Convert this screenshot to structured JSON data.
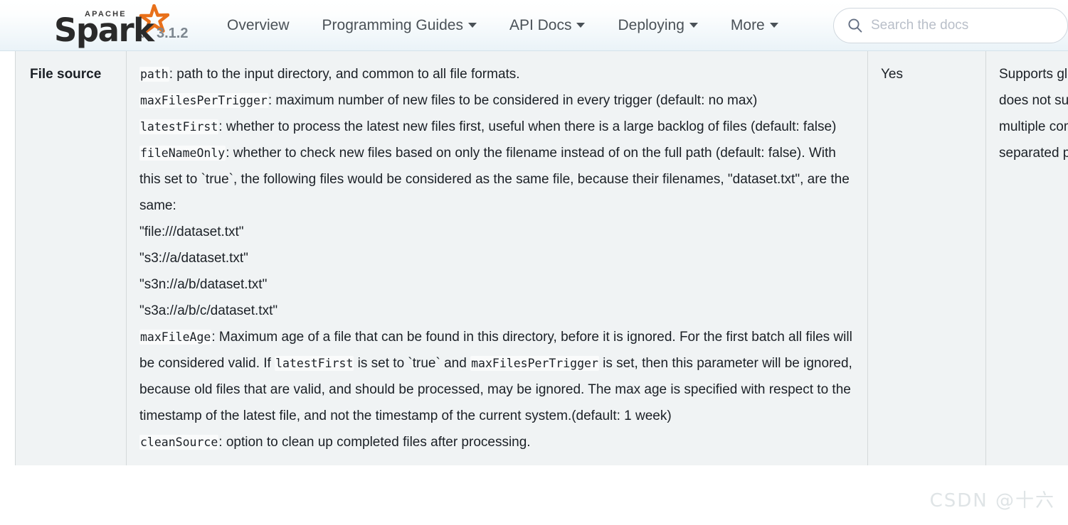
{
  "navbar": {
    "brand": {
      "apache_label": "APACHE",
      "spark_label": "Spark",
      "tm_label": "™",
      "version": "3.1.2",
      "star_icon": "star-icon"
    },
    "links": [
      {
        "label": "Overview",
        "has_caret": false
      },
      {
        "label": "Programming Guides",
        "has_caret": true
      },
      {
        "label": "API Docs",
        "has_caret": true
      },
      {
        "label": "Deploying",
        "has_caret": true
      },
      {
        "label": "More",
        "has_caret": true
      }
    ],
    "search": {
      "placeholder": "Search the docs",
      "value": "",
      "icon": "search-icon"
    }
  },
  "table": {
    "row": {
      "name": "File source",
      "fault_tolerant": "Yes",
      "notes": "Supports glob paths, but does not support multiple comma-separated paths/globs.",
      "description_lines": [
        {
          "code": "path",
          "text": ": path to the input directory, and common to all file formats."
        },
        {
          "code": "maxFilesPerTrigger",
          "text": ": maximum number of new files to be considered in every trigger (default: no max)"
        },
        {
          "code": "latestFirst",
          "text": ": whether to process the latest new files first, useful when there is a large backlog of files (default: false)"
        },
        {
          "code": "fileNameOnly",
          "text": ": whether to check new files based on only the filename instead of on the full path (default: false). With this set to `true`, the following files would be considered as the same file, because their filenames, \"dataset.txt\", are the same:"
        },
        {
          "code": "",
          "text": "\"file:///dataset.txt\""
        },
        {
          "code": "",
          "text": "\"s3://a/dataset.txt\""
        },
        {
          "code": "",
          "text": "\"s3n://a/b/dataset.txt\""
        },
        {
          "code": "",
          "text": "\"s3a://a/b/c/dataset.txt\""
        }
      ],
      "max_file_age": {
        "code": "maxFileAge",
        "part1": ": Maximum age of a file that can be found in this directory, before it is ignored. For the first batch all files will be considered valid. If ",
        "code2": "latestFirst",
        "part2": " is set to `true` and ",
        "code3": "maxFilesPerTrigger",
        "part3": " is set, then this parameter will be ignored, because old files that are valid, and should be processed, may be ignored. The max age is specified with respect to the timestamp of the latest file, and not the timestamp of the current system.(default: 1 week)"
      },
      "clean_source": {
        "code": "cleanSource",
        "text": ": option to clean up completed files after processing."
      }
    }
  },
  "watermark": "CSDN @十六",
  "colors": {
    "accent_orange": "#e8701a",
    "table_bg": "#f0f3f4",
    "border": "#d4d8da",
    "nav_text": "#4a5157"
  }
}
